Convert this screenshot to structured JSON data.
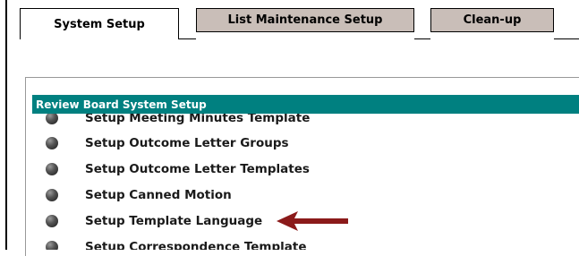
{
  "tabs": [
    {
      "label": "System Setup",
      "active": true
    },
    {
      "label": "List Maintenance Setup",
      "active": false
    },
    {
      "label": "Clean-up",
      "active": false
    }
  ],
  "panel": {
    "title": "Review Board System Setup",
    "items": [
      {
        "label": "Setup Meeting Minutes Template"
      },
      {
        "label": "Setup Outcome Letter Groups"
      },
      {
        "label": "Setup Outcome Letter Templates"
      },
      {
        "label": "Setup Canned Motion"
      },
      {
        "label": "Setup Template Language"
      },
      {
        "label": "Setup Correspondence Template"
      }
    ]
  },
  "colors": {
    "header_bg": "#008080",
    "inactive_tab_bg": "#c9beb8",
    "arrow": "#8b1a1a"
  },
  "annotations": {
    "arrow_points_to": "Setup Template Language",
    "arrow_icon": "left-arrow-icon"
  }
}
